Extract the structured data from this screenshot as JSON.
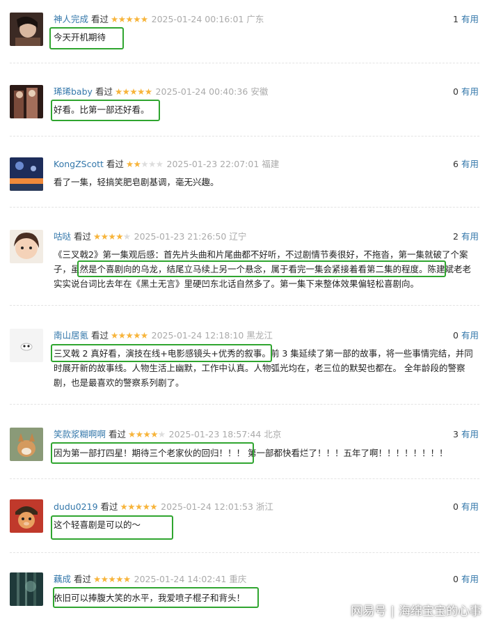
{
  "useful_label": "有用",
  "watched_label": "看过",
  "reviews": [
    {
      "user": "神人完成",
      "stars": 5,
      "time": "2025-01-24 00:16:01",
      "location": "广东",
      "useful": "1",
      "text": "今天开机期待"
    },
    {
      "user": "琋琋baby",
      "stars": 5,
      "time": "2025-01-24 00:40:36",
      "location": "安徽",
      "useful": "0",
      "text": "好看。比第一部还好看。"
    },
    {
      "user": "KongZScott",
      "stars": 2,
      "time": "2025-01-23 22:07:01",
      "location": "福建",
      "useful": "6",
      "text": "看了一集，轻搞笑肥皂剧基调，毫无兴趣。"
    },
    {
      "user": "咕哒",
      "stars": 4,
      "time": "2025-01-23 21:26:50",
      "location": "辽宁",
      "useful": "2",
      "text": "《三叉戟2》第一集观后感：首先片头曲和片尾曲都不好听，不过剧情节奏很好，不拖沓，第一集就破了个案子，虽然是个喜剧向的乌龙，结尾立马续上另一个悬念，属于看完一集会紧接着看第二集的程度。陈建斌老老实实说台词比去年在《黑土无言》里硬凹东北话自然多了。第一集下来整体效果偏轻松喜剧向。"
    },
    {
      "user": "南山居氪",
      "stars": 5,
      "time": "2025-01-24 12:18:10",
      "location": "黑龙江",
      "useful": "0",
      "text": "三叉戟 2 真好看，演技在线+电影感镜头+优秀的叙事。前 3 集延续了第一部的故事，将一些事情完结，并同时展开新的故事线。人物生活上幽默，工作中认真。人物弧光均在，老三位的默契也都在。 全年龄段的警察剧，也是最喜欢的警察系列剧了。"
    },
    {
      "user": "笑款浆糊啊啊",
      "stars": 4,
      "time": "2025-01-23 18:57:44",
      "location": "北京",
      "useful": "3",
      "text": "因为第一部打四星！期待三个老家伙的回归！！！ 第一部都快看烂了！！！五年了啊！！！！！！！！"
    },
    {
      "user": "dudu0219",
      "stars": 5,
      "time": "2025-01-24 12:01:53",
      "location": "浙江",
      "useful": "0",
      "text": "这个轻喜剧是可以的～"
    },
    {
      "user": "藕成",
      "stars": 5,
      "time": "2025-01-24 14:02:41",
      "location": "重庆",
      "useful": "0",
      "text": "依旧可以捧腹大笑的水平，我爱喷子棍子和背头！"
    }
  ],
  "watermark": {
    "brand": "网易号",
    "author": "海绵宝宝的心事"
  },
  "colors": {
    "link": "#3377aa",
    "star": "#f7b43a",
    "highlight": "#2fa52f",
    "muted": "#aaaaaa"
  }
}
